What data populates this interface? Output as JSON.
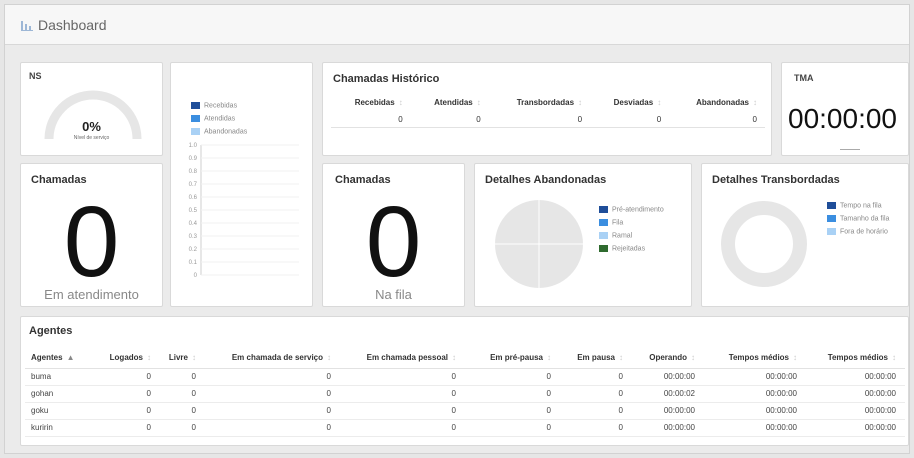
{
  "header": {
    "title": "Dashboard",
    "icon": "bar-chart-icon"
  },
  "ns": {
    "title": "NS",
    "value": "0%",
    "label": "Nível de serviço"
  },
  "bar_legend": [
    {
      "label": "Recebidas",
      "color": "#1f4e99"
    },
    {
      "label": "Atendidas",
      "color": "#3b8ee0"
    },
    {
      "label": "Abandonadas",
      "color": "#a9d1f5"
    }
  ],
  "historico": {
    "title": "Chamadas Histórico",
    "columns": [
      "Recebidas",
      "Atendidas",
      "Transbordadas",
      "Desviadas",
      "Abandonadas"
    ],
    "values": [
      "0",
      "0",
      "0",
      "0",
      "0"
    ]
  },
  "tma": {
    "title": "TMA",
    "value": "00:00:00"
  },
  "chamadas_atendimento": {
    "title": "Chamadas",
    "value": "0",
    "label": "Em atendimento"
  },
  "chamadas_fila": {
    "title": "Chamadas",
    "value": "0",
    "label": "Na fila"
  },
  "abandonadas": {
    "title": "Detalhes Abandonadas",
    "legend": [
      {
        "label": "Pré-atendimento",
        "color": "#1f4e99"
      },
      {
        "label": "Fila",
        "color": "#3b8ee0"
      },
      {
        "label": "Ramal",
        "color": "#a9d1f5"
      },
      {
        "label": "Rejeitadas",
        "color": "#2f6b2f"
      }
    ]
  },
  "transbordadas": {
    "title": "Detalhes Transbordadas",
    "legend": [
      {
        "label": "Tempo na fila",
        "color": "#1f4e99"
      },
      {
        "label": "Tamanho da fila",
        "color": "#3b8ee0"
      },
      {
        "label": "Fora de horário",
        "color": "#a9d1f5"
      }
    ]
  },
  "chart_data": {
    "type": "bar",
    "categories": [],
    "series": [
      {
        "name": "Recebidas",
        "values": []
      },
      {
        "name": "Atendidas",
        "values": []
      },
      {
        "name": "Abandonadas",
        "values": []
      }
    ],
    "yticks": [
      "1.0",
      "0.9",
      "0.8",
      "0.7",
      "0.6",
      "0.5",
      "0.4",
      "0.3",
      "0.2",
      "0.1",
      "0"
    ],
    "ylim": [
      0,
      1
    ]
  },
  "agents": {
    "title": "Agentes",
    "columns": [
      "Agentes",
      "Logados",
      "Livre",
      "Em chamada de serviço",
      "Em chamada pessoal",
      "Em pré-pausa",
      "Em pausa",
      "Operando",
      "Tempos médios",
      "Tempos médios"
    ],
    "rows": [
      [
        "buma",
        "0",
        "0",
        "0",
        "0",
        "0",
        "0",
        "00:00:00",
        "00:00:00",
        "00:00:00"
      ],
      [
        "gohan",
        "0",
        "0",
        "0",
        "0",
        "0",
        "0",
        "00:00:02",
        "00:00:00",
        "00:00:00"
      ],
      [
        "goku",
        "0",
        "0",
        "0",
        "0",
        "0",
        "0",
        "00:00:00",
        "00:00:00",
        "00:00:00"
      ],
      [
        "kuririn",
        "0",
        "0",
        "0",
        "0",
        "0",
        "0",
        "00:00:00",
        "00:00:00",
        "00:00:00"
      ]
    ]
  }
}
